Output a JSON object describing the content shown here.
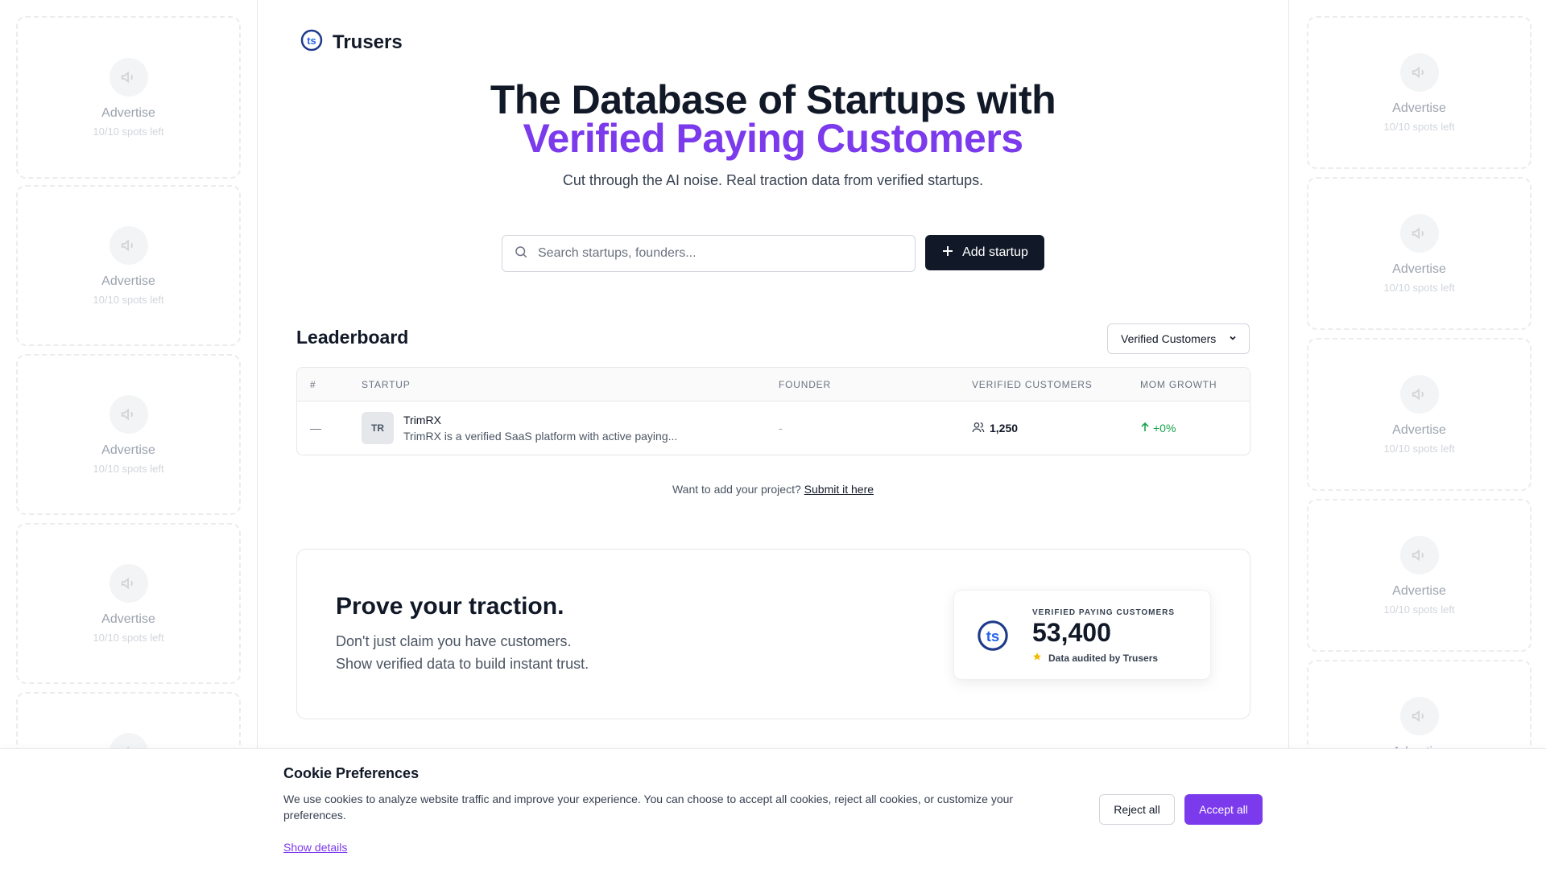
{
  "brand": {
    "name": "Trusers",
    "logo_icon": "trusers-logo-icon"
  },
  "hero": {
    "title_line1": "The Database of Startups with",
    "title_line2": "Verified Paying Customers",
    "subtitle": "Cut through the AI noise. Real traction data from verified startups."
  },
  "search": {
    "placeholder": "Search startups, founders...",
    "value": ""
  },
  "add_startup": {
    "label": "Add startup"
  },
  "ads": {
    "title": "Advertise",
    "spots": "10/10 spots left"
  },
  "leaderboard": {
    "title": "Leaderboard",
    "filter": "Verified Customers",
    "columns": [
      "#",
      "Startup",
      "Founder",
      "Verified Customers",
      "MoM Growth"
    ],
    "rows": [
      {
        "rank": "—",
        "initials": "TR",
        "name": "TrimRX",
        "description": "TrimRX is a verified SaaS platform with active paying...",
        "founder": "-",
        "customers": "1,250",
        "growth": "+0%"
      }
    ]
  },
  "submit": {
    "prompt": "Want to add your project?",
    "link": "Submit it here"
  },
  "traction": {
    "title": "Prove your traction.",
    "line1": "Don't just claim you have customers.",
    "line2": "Show verified data to build instant trust.",
    "card_caption": "Verified Paying Customers",
    "card_value": "53,400",
    "card_audit": "Data audited by Trusers"
  },
  "cookie": {
    "title": "Cookie Preferences",
    "text": "We use cookies to analyze website traffic and improve your experience. You can choose to accept all cookies, reject all cookies, or customize your preferences.",
    "details": "Show details",
    "reject": "Reject all",
    "accept": "Accept all"
  },
  "colors": {
    "accent": "#7c3aed",
    "dark": "#111827",
    "growth": "#16a34a",
    "star": "#f5b800"
  }
}
